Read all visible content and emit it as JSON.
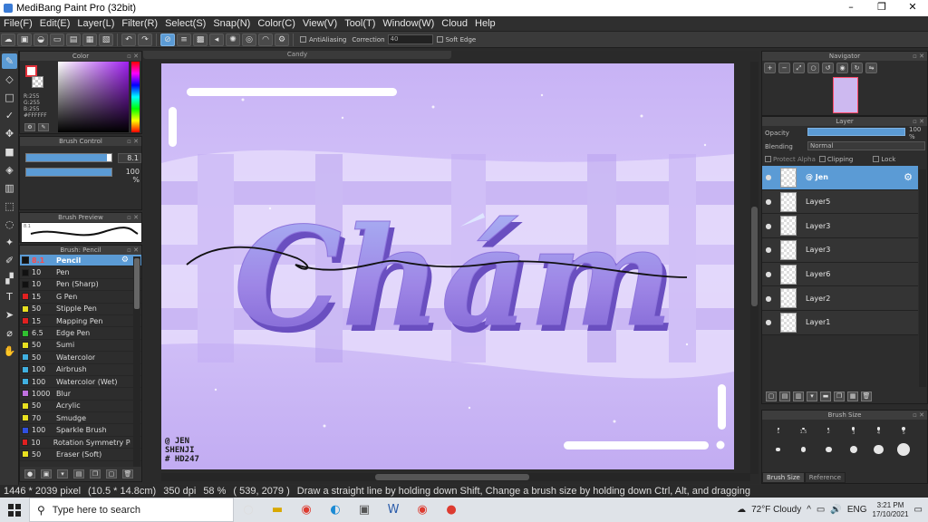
{
  "window": {
    "title": "MediBang Paint Pro (32bit)",
    "controls": [
      "–",
      "❐",
      "✕"
    ]
  },
  "menu": [
    "File(F)",
    "Edit(E)",
    "Layer(L)",
    "Filter(R)",
    "Select(S)",
    "Snap(N)",
    "Color(C)",
    "View(V)",
    "Tool(T)",
    "Window(W)",
    "Cloud",
    "Help"
  ],
  "toolbar": {
    "antialiasing_label": "AntiAliasing",
    "correction_label": "Correction",
    "correction_value": "40",
    "soft_edge_label": "Soft Edge"
  },
  "color_panel": {
    "title": "Color",
    "r": "R:255",
    "g": "G:255",
    "b": "B:255",
    "hex": "#FFFFFF",
    "foreground": "#ffffff",
    "accent_red": "#e0303a"
  },
  "brush_control": {
    "title": "Brush Control",
    "size_value": "8.1",
    "size_fill_percent": 95,
    "opacity_value": "100 %",
    "opacity_fill_percent": 100
  },
  "brush_preview": {
    "title": "Brush Preview",
    "size_label": "8.1"
  },
  "brush_list": {
    "title": "Brush: Pencil",
    "items": [
      {
        "size": "8.1",
        "name": "Pencil",
        "color": "#111111",
        "selected": true
      },
      {
        "size": "10",
        "name": "Pen",
        "color": "#111111"
      },
      {
        "size": "10",
        "name": "Pen (Sharp)",
        "color": "#111111"
      },
      {
        "size": "15",
        "name": "G Pen",
        "color": "#e02020"
      },
      {
        "size": "50",
        "name": "Stipple Pen",
        "color": "#e8e020"
      },
      {
        "size": "15",
        "name": "Mapping Pen",
        "color": "#e02020"
      },
      {
        "size": "6.5",
        "name": "Edge Pen",
        "color": "#30c030"
      },
      {
        "size": "50",
        "name": "Sumi",
        "color": "#e8e020"
      },
      {
        "size": "50",
        "name": "Watercolor",
        "color": "#40b0e0"
      },
      {
        "size": "100",
        "name": "Airbrush",
        "color": "#40b0e0"
      },
      {
        "size": "100",
        "name": "Watercolor (Wet)",
        "color": "#40b0e0"
      },
      {
        "size": "1000",
        "name": "Blur",
        "color": "#c070e0"
      },
      {
        "size": "50",
        "name": "Acrylic",
        "color": "#e8e020"
      },
      {
        "size": "70",
        "name": "Smudge",
        "color": "#e8e020"
      },
      {
        "size": "100",
        "name": "Sparkle Brush",
        "color": "#3050e0"
      },
      {
        "size": "10",
        "name": "Rotation Symmetry Pen",
        "color": "#e02020"
      },
      {
        "size": "50",
        "name": "Eraser (Soft)",
        "color": "#e8e020"
      }
    ]
  },
  "canvas": {
    "tab_label": "Candy",
    "lettering": "Chám",
    "signature_line1": "@ JEN",
    "signature_line2": "SHENJI",
    "signature_line3": "# HD247"
  },
  "navigator": {
    "title": "Navigator"
  },
  "layer_panel": {
    "title": "Layer",
    "opacity_label": "Opacity",
    "opacity_value": "100 %",
    "blending_label": "Blending",
    "blending_value": "Normal",
    "protect_alpha_label": "Protect Alpha",
    "clipping_label": "Clipping",
    "lock_label": "Lock",
    "layers": [
      {
        "name": "@ Jen",
        "selected": true
      },
      {
        "name": "Layer5"
      },
      {
        "name": "Layer3"
      },
      {
        "name": "Layer3"
      },
      {
        "name": "Layer6"
      },
      {
        "name": "Layer2"
      },
      {
        "name": "Layer1"
      }
    ]
  },
  "brush_size_panel": {
    "title": "Brush Size",
    "sizes": [
      "1",
      "1.5",
      "2",
      "3",
      "4",
      "5"
    ],
    "tab_brush_size": "Brush Size",
    "tab_reference": "Reference"
  },
  "status": {
    "pixels": "1446 * 2039 pixel",
    "cm": "(10.5 * 14.8cm)",
    "dpi": "350 dpi",
    "zoom": "58 %",
    "coords": "( 539, 2079 )",
    "hint": "Draw a straight line by holding down Shift, Change a brush size by holding down Ctrl, Alt, and dragging"
  },
  "taskbar": {
    "search_placeholder": "Type here to search",
    "weather": "72°F  Cloudy",
    "lang": "ENG",
    "time": "3:21 PM",
    "date": "17/10/2021"
  }
}
